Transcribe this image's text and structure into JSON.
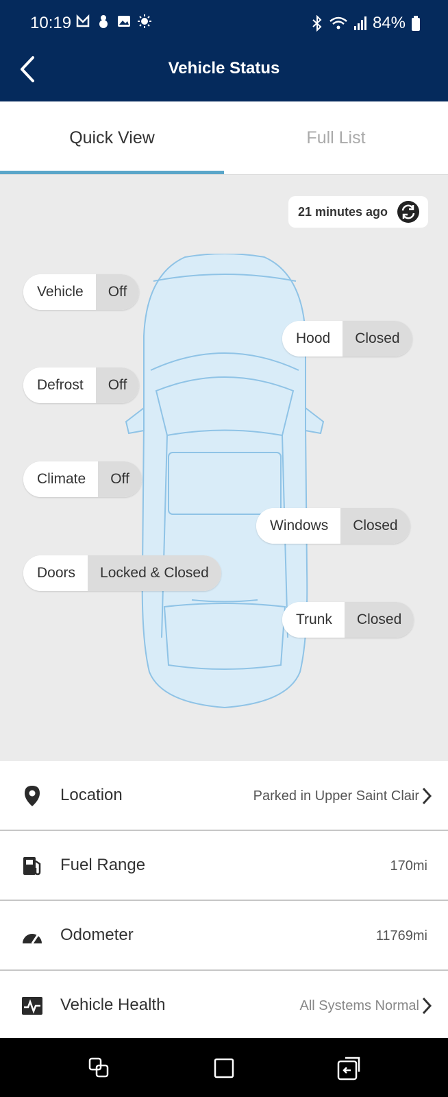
{
  "status_bar": {
    "time": "10:19",
    "battery": "84%"
  },
  "header": {
    "title": "Vehicle Status"
  },
  "tabs": [
    {
      "label": "Quick View"
    },
    {
      "label": "Full List"
    }
  ],
  "quick_view": {
    "updated": "21 minutes ago",
    "status": {
      "vehicle": {
        "label": "Vehicle",
        "value": "Off"
      },
      "hood": {
        "label": "Hood",
        "value": "Closed"
      },
      "defrost": {
        "label": "Defrost",
        "value": "Off"
      },
      "climate": {
        "label": "Climate",
        "value": "Off"
      },
      "windows": {
        "label": "Windows",
        "value": "Closed"
      },
      "doors": {
        "label": "Doors",
        "value": "Locked & Closed"
      },
      "trunk": {
        "label": "Trunk",
        "value": "Closed"
      }
    }
  },
  "details": {
    "location": {
      "label": "Location",
      "value": "Parked in Upper Saint Clair",
      "icon": "location-pin-icon"
    },
    "fuel": {
      "label": "Fuel Range",
      "value": "170mi",
      "icon": "fuel-pump-icon"
    },
    "odometer": {
      "label": "Odometer",
      "value": "11769mi",
      "icon": "speedometer-icon"
    },
    "health": {
      "label": "Vehicle Health",
      "value": "All Systems Normal",
      "icon": "health-pulse-icon"
    }
  },
  "colors": {
    "header": "#052a5c",
    "accent": "#5aa6c9",
    "car_fill": "#d9ecf8",
    "car_stroke": "#8fc3e6"
  }
}
